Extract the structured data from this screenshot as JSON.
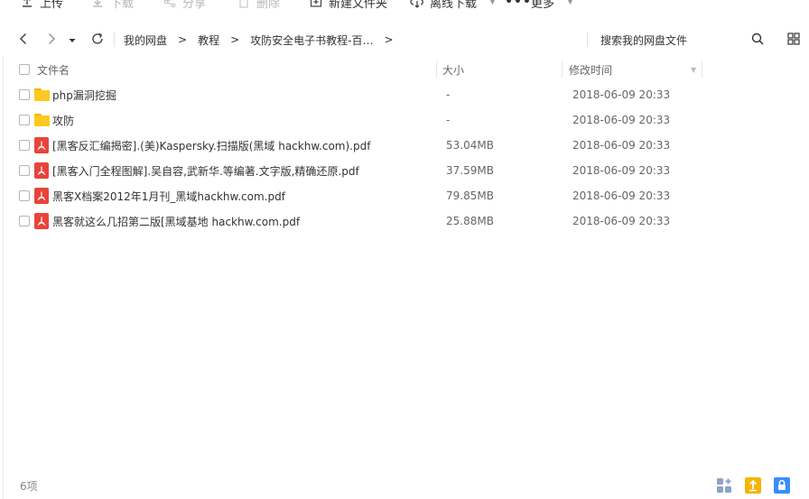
{
  "toolbar": {
    "upload": "上传",
    "download": "下载",
    "share": "分享",
    "delete": "删除",
    "new_folder": "新建文件夹",
    "offline_download": "离线下载",
    "more": "更多"
  },
  "nav": {
    "breadcrumbs": [
      "我的网盘",
      "教程",
      "攻防安全电子书教程-百…"
    ],
    "separator": ">",
    "search_placeholder": "搜索我的网盘文件"
  },
  "table": {
    "headers": {
      "name": "文件名",
      "size": "大小",
      "modified": "修改时间"
    },
    "rows": [
      {
        "type": "folder",
        "name": "php漏洞挖掘",
        "size": "-",
        "modified": "2018-06-09 20:33"
      },
      {
        "type": "folder",
        "name": "攻防",
        "size": "-",
        "modified": "2018-06-09 20:33"
      },
      {
        "type": "pdf",
        "name": "[黑客反汇编揭密].(美)Kaspersky.扫描版(黑域 hackhw.com).pdf",
        "size": "53.04MB",
        "modified": "2018-06-09 20:33"
      },
      {
        "type": "pdf",
        "name": "[黑客入门全程图解].吴自容,武新华.等编著.文字版,精确还原.pdf",
        "size": "37.59MB",
        "modified": "2018-06-09 20:33"
      },
      {
        "type": "pdf",
        "name": "黑客X档案2012年1月刊_黑域hackhw.com.pdf",
        "size": "79.85MB",
        "modified": "2018-06-09 20:33"
      },
      {
        "type": "pdf",
        "name": "黑客就这么几招第二版[黑域基地 hackhw.com.pdf",
        "size": "25.88MB",
        "modified": "2018-06-09 20:33"
      }
    ]
  },
  "status": {
    "count": "6项"
  },
  "icons": {
    "upload": "upload-icon",
    "download": "download-icon",
    "share": "share-icon",
    "delete": "trash-icon",
    "new_folder": "folder-plus-icon",
    "offline": "cloud-download-icon",
    "more": "ellipsis-icon",
    "back": "chevron-left-icon",
    "forward": "chevron-right-icon",
    "refresh": "refresh-icon",
    "search": "search-icon",
    "view": "grid-view-icon"
  },
  "colors": {
    "folder": "#ffc81e",
    "pdf": "#e8443a",
    "accent": "#3b8cff",
    "transfer": "#f5b400"
  }
}
